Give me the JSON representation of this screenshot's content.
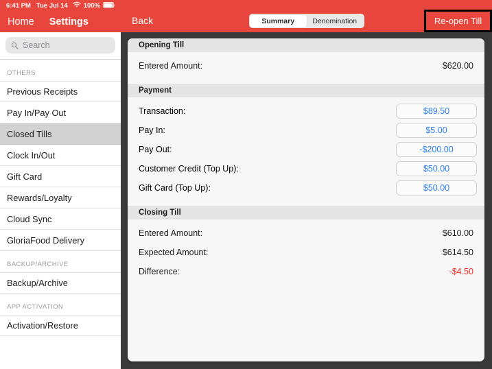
{
  "status_bar": {
    "time": "6:41 PM",
    "date": "Tue Jul 14",
    "battery": "100%",
    "wifi_icon": "wifi-icon",
    "battery_icon": "battery-full-icon"
  },
  "sidebar": {
    "nav": {
      "home_label": "Home",
      "settings_label": "Settings"
    },
    "search": {
      "placeholder": "Search",
      "value": "",
      "icon": "search-icon"
    },
    "groups": [
      {
        "label": "OTHERS",
        "items": [
          {
            "label": "Previous Receipts",
            "selected": false
          },
          {
            "label": "Pay In/Pay Out",
            "selected": false
          },
          {
            "label": "Closed Tills",
            "selected": true
          },
          {
            "label": "Clock In/Out",
            "selected": false
          },
          {
            "label": "Gift Card",
            "selected": false
          },
          {
            "label": "Rewards/Loyalty",
            "selected": false
          },
          {
            "label": "Cloud Sync",
            "selected": false
          },
          {
            "label": "GloriaFood Delivery",
            "selected": false
          }
        ]
      },
      {
        "label": "BACKUP/ARCHIVE",
        "items": [
          {
            "label": "Backup/Archive",
            "selected": false
          }
        ]
      },
      {
        "label": "APP ACTIVATION",
        "items": [
          {
            "label": "Activation/Restore",
            "selected": false
          }
        ]
      }
    ]
  },
  "topbar": {
    "back_label": "Back",
    "segments": [
      {
        "label": "Summary",
        "active": true
      },
      {
        "label": "Denomination",
        "active": false
      }
    ],
    "reopen_label": "Re-open Till",
    "highlight_color": "#000000",
    "bar_color": "#e8453c"
  },
  "main": {
    "sections": [
      {
        "title": "Opening Till",
        "rows": [
          {
            "label": "Entered Amount:",
            "value": "$620.00",
            "style": "plain"
          }
        ]
      },
      {
        "title": "Payment",
        "rows": [
          {
            "label": "Transaction:",
            "value": "$89.50",
            "style": "pill"
          },
          {
            "label": "Pay In:",
            "value": "$5.00",
            "style": "pill"
          },
          {
            "label": "Pay Out:",
            "value": "-$200.00",
            "style": "pill"
          },
          {
            "label": "Customer Credit (Top Up):",
            "value": "$50.00",
            "style": "pill"
          },
          {
            "label": "Gift Card (Top Up):",
            "value": "$50.00",
            "style": "pill"
          }
        ]
      },
      {
        "title": "Closing Till",
        "rows": [
          {
            "label": "Entered Amount:",
            "value": "$610.00",
            "style": "plain"
          },
          {
            "label": "Expected Amount:",
            "value": "$614.50",
            "style": "plain"
          },
          {
            "label": "Difference:",
            "value": "-$4.50",
            "style": "plain-negative"
          }
        ]
      }
    ]
  },
  "colors": {
    "accent_red": "#e8453c",
    "link_blue": "#2b7ef5",
    "negative_red": "#ff2b20",
    "card_bg": "#f7f7f7",
    "section_header_bg": "#e4e4e4",
    "selected_row": "#d2d2d2"
  }
}
